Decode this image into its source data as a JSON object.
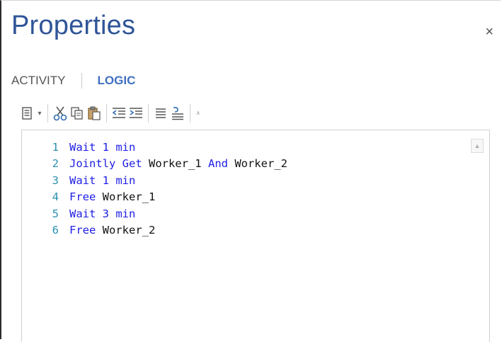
{
  "panel": {
    "title": "Properties",
    "close_glyph": "×"
  },
  "tabs": [
    {
      "label": "ACTIVITY",
      "active": false
    },
    {
      "label": "LOGIC",
      "active": true
    }
  ],
  "toolbar": {
    "icons": [
      "document-dropdown-icon",
      "chevron-down-icon",
      "cut-icon",
      "copy-icon",
      "paste-icon",
      "outdent-icon",
      "indent-icon",
      "align-icon",
      "comment-icon",
      "overflow-icon"
    ]
  },
  "editor": {
    "lines": [
      {
        "num": "1",
        "tokens": [
          {
            "t": "Wait 1 min",
            "kw": true
          }
        ]
      },
      {
        "num": "2",
        "tokens": [
          {
            "t": "Jointly Get ",
            "kw": true
          },
          {
            "t": "Worker_1 ",
            "kw": false
          },
          {
            "t": "And ",
            "kw": true
          },
          {
            "t": "Worker_2",
            "kw": false
          }
        ]
      },
      {
        "num": "3",
        "tokens": [
          {
            "t": "Wait 1 min",
            "kw": true
          }
        ]
      },
      {
        "num": "4",
        "tokens": [
          {
            "t": "Free ",
            "kw": true
          },
          {
            "t": "Worker_1",
            "kw": false
          }
        ]
      },
      {
        "num": "5",
        "tokens": [
          {
            "t": "Wait 3 min",
            "kw": true
          }
        ]
      },
      {
        "num": "6",
        "tokens": [
          {
            "t": "Free ",
            "kw": true
          },
          {
            "t": "Worker_2",
            "kw": false
          }
        ]
      }
    ]
  },
  "colors": {
    "title": "#2f5597",
    "keyword": "#1e1ee6",
    "line_number": "#2b91af",
    "active_tab": "#3f6fc1"
  }
}
